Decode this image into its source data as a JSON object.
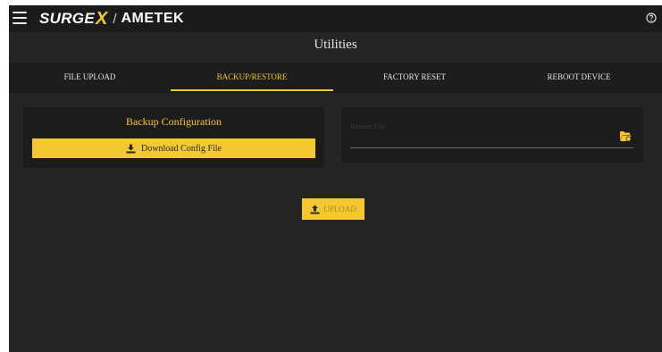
{
  "header": {
    "brand_surge": "SURGE",
    "brand_x": "X",
    "brand_separator": "/",
    "brand_ametek": "AMETEK",
    "menu_icon": "hamburger-menu-icon",
    "help_icon": "help-circle-icon"
  },
  "page": {
    "title": "Utilities"
  },
  "tabs": [
    {
      "label": "FILE UPLOAD",
      "active": false
    },
    {
      "label": "BACKUP/RESTORE",
      "active": true
    },
    {
      "label": "FACTORY RESET",
      "active": false
    },
    {
      "label": "REBOOT DEVICE",
      "active": false
    }
  ],
  "backup": {
    "title": "Backup Configuration",
    "download_label": "Download Config File",
    "download_icon": "download-icon"
  },
  "restore": {
    "file_label": "Restore File",
    "file_value": "",
    "folder_icon": "folder-open-icon"
  },
  "upload": {
    "label": "UPLOAD",
    "icon": "upload-icon"
  },
  "colors": {
    "accent": "#f3c832",
    "background": "#252525",
    "topbar": "#1b1b1b",
    "card": "#1c1c1c"
  }
}
